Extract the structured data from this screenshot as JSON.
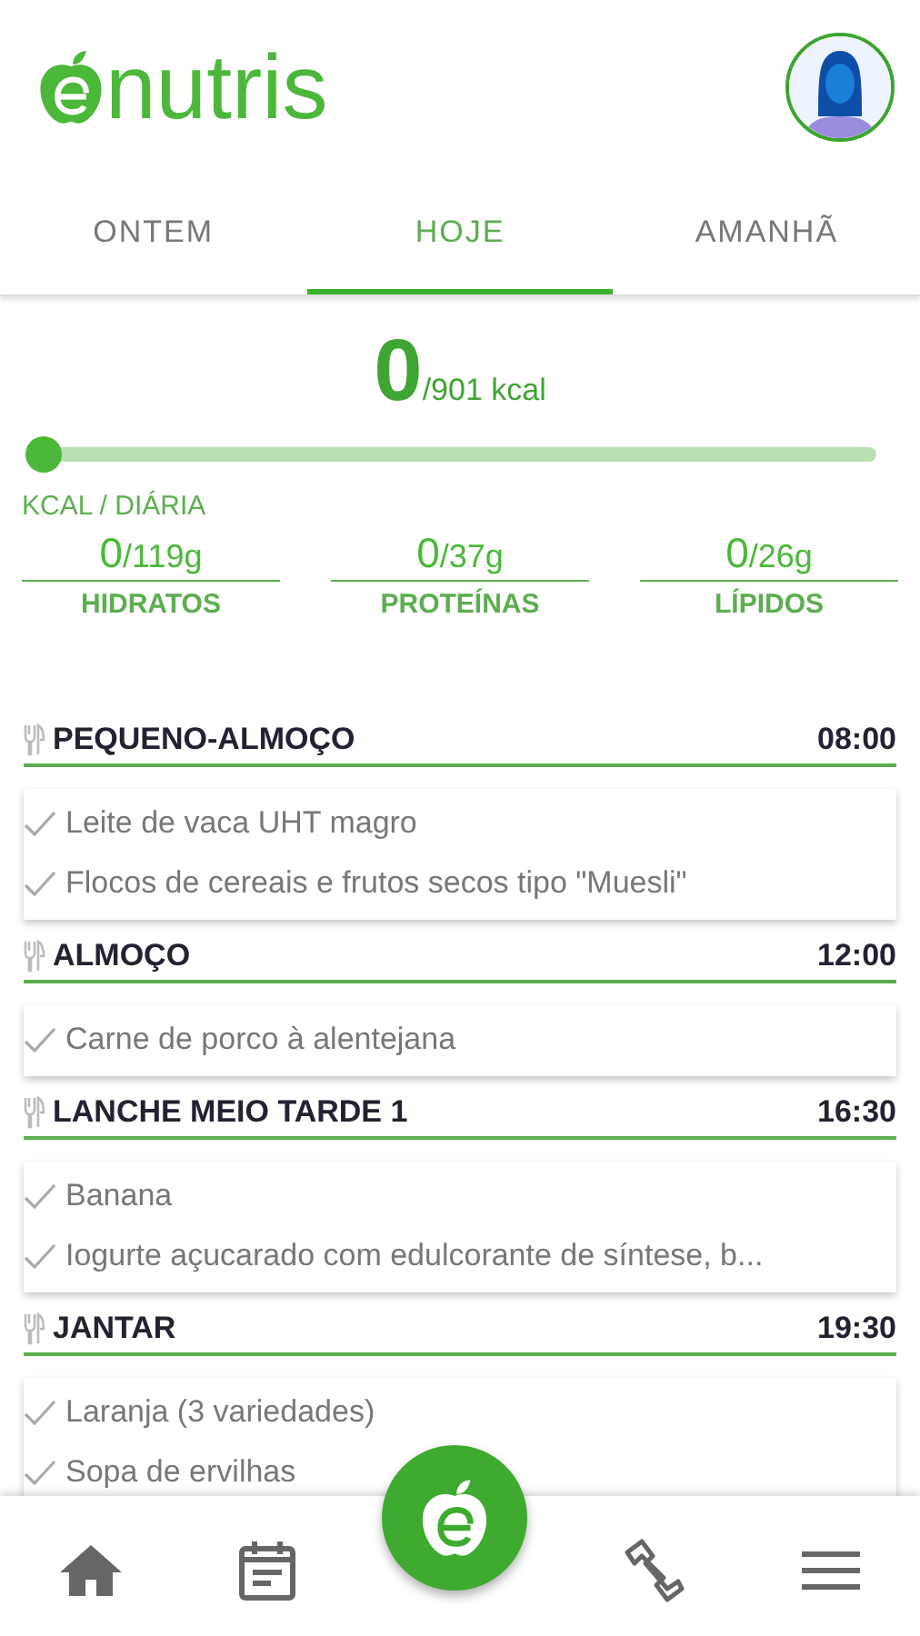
{
  "app": {
    "logo_text": "nutris"
  },
  "tabs": [
    {
      "label": "ONTEM",
      "selected": false
    },
    {
      "label": "HOJE",
      "selected": true
    },
    {
      "label": "AMANHÃ",
      "selected": false
    }
  ],
  "calories": {
    "consumed": "0",
    "target": "/901 kcal",
    "level": 0,
    "label": "KCAL / DIÁRIA"
  },
  "macros": [
    {
      "consumed": "0",
      "target": "/119g",
      "label": "HIDRATOS"
    },
    {
      "consumed": "0",
      "target": "/37g",
      "label": "PROTEÍNAS"
    },
    {
      "consumed": "0",
      "target": "/26g",
      "label": "LÍPIDOS"
    }
  ],
  "meals": [
    {
      "name": "PEQUENO-ALMOÇO",
      "time": "08:00",
      "foods": [
        "Leite de vaca UHT magro",
        "Flocos de cereais e frutos secos tipo \"Muesli\""
      ]
    },
    {
      "name": "ALMOÇO",
      "time": "12:00",
      "foods": [
        "Carne de porco à alentejana"
      ]
    },
    {
      "name": "LANCHE MEIO TARDE 1",
      "time": "16:30",
      "foods": [
        "Banana",
        "Iogurte açucarado com edulcorante de síntese, b..."
      ]
    },
    {
      "name": "JANTAR",
      "time": "19:30",
      "foods": [
        "Laranja (3 variedades)",
        "Sopa de ervilhas"
      ]
    }
  ],
  "bottom_nav": [
    {
      "kind": "home"
    },
    {
      "kind": "calendar"
    },
    {
      "kind": "fab"
    },
    {
      "kind": "exercise"
    },
    {
      "kind": "menu"
    }
  ]
}
